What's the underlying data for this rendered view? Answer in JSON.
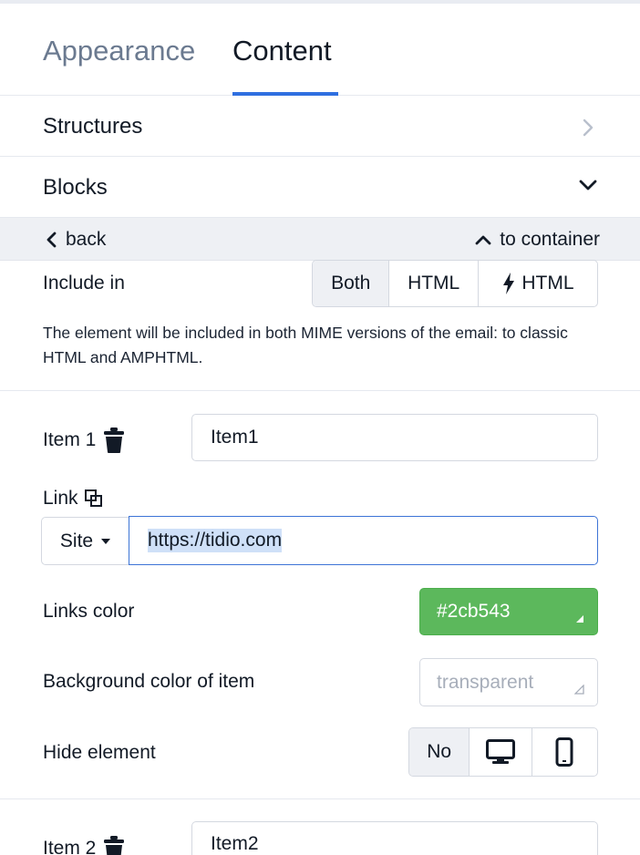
{
  "tabs": [
    {
      "label": "Appearance",
      "active": false
    },
    {
      "label": "Content",
      "active": true
    }
  ],
  "sections": {
    "structures": "Structures",
    "blocks": "Blocks"
  },
  "nav": {
    "back": "back",
    "to_container": "to container"
  },
  "include_in": {
    "label": "Include in",
    "options": [
      "Both",
      "HTML",
      "HTML"
    ],
    "selected": "Both",
    "description": "The element will be included in both MIME versions of the email: to classic HTML and AMPHTML."
  },
  "item1": {
    "label": "Item 1",
    "value": "Item1"
  },
  "link": {
    "label": "Link",
    "type": "Site",
    "url": "https://tidio.com"
  },
  "links_color": {
    "label": "Links color",
    "value": "#2cb543",
    "swatch": "#5cb85c"
  },
  "bg_color": {
    "label": "Background color of item",
    "value": "transparent"
  },
  "hide_element": {
    "label": "Hide element",
    "options": [
      "No",
      "desktop-icon",
      "mobile-icon"
    ],
    "selected": "No"
  },
  "item2": {
    "label": "Item 2",
    "value": "Item2"
  },
  "colors": {
    "accent": "#2f6fe0",
    "muted_tab": "#6b7a90",
    "border": "#d4d8e0"
  }
}
